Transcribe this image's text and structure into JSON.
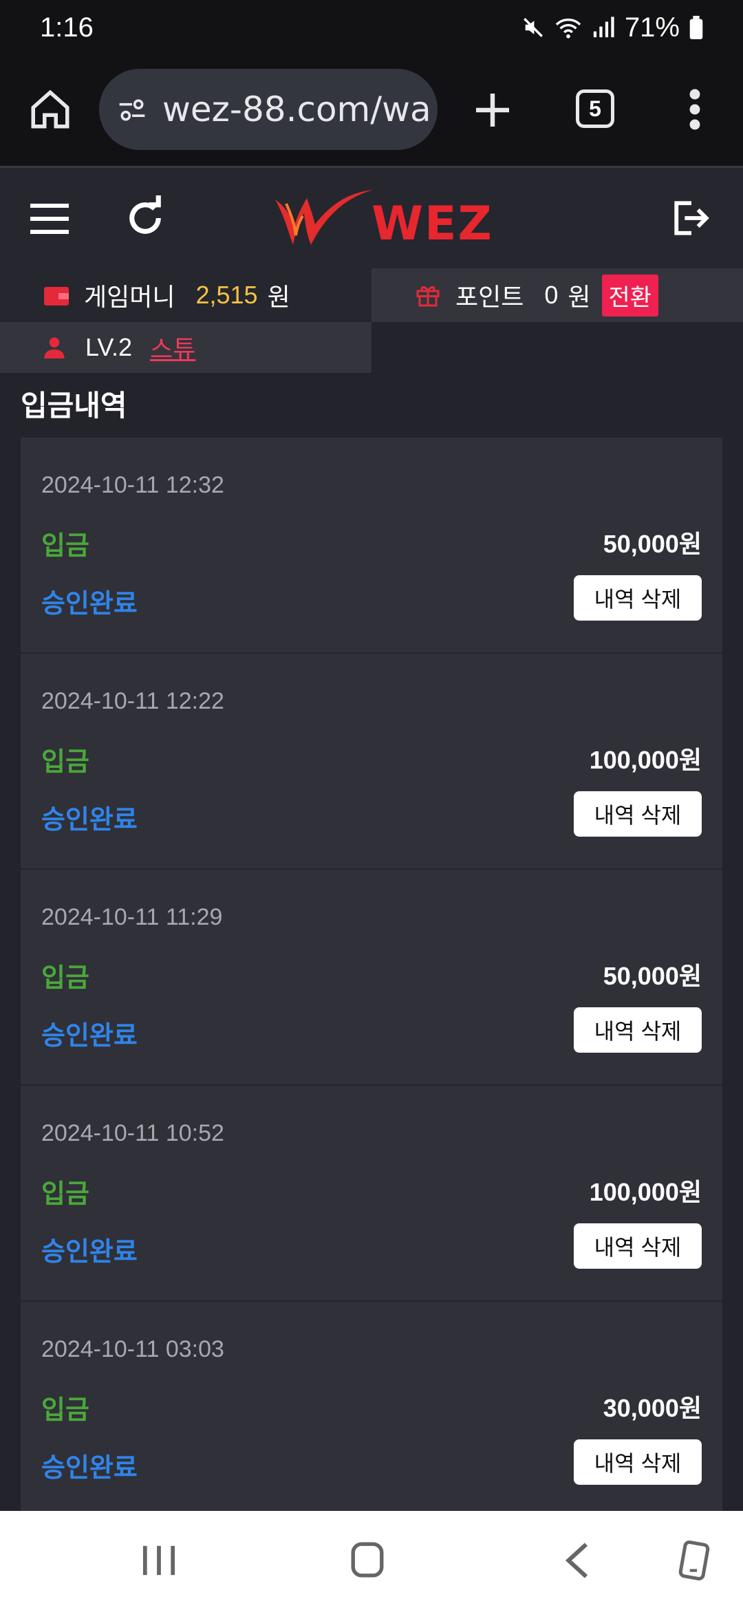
{
  "status_bar": {
    "time": "1:16",
    "battery": "71%"
  },
  "browser": {
    "url": "wez-88.com/wa",
    "tab_count": "5"
  },
  "header": {
    "logo_text": "WEZ"
  },
  "account": {
    "money_label": "게임머니",
    "money_value": "2,515",
    "money_unit": "원",
    "point_label": "포인트",
    "point_value": "0",
    "point_unit": "원",
    "convert_label": "전환",
    "level": "LV.2",
    "grade": "스튜"
  },
  "section_title": "입금내역",
  "deposits": [
    {
      "date": "2024-10-11 12:32",
      "type": "입금",
      "amount": "50,000원",
      "status": "승인완료",
      "delete_label": "내역 삭제"
    },
    {
      "date": "2024-10-11 12:22",
      "type": "입금",
      "amount": "100,000원",
      "status": "승인완료",
      "delete_label": "내역 삭제"
    },
    {
      "date": "2024-10-11 11:29",
      "type": "입금",
      "amount": "50,000원",
      "status": "승인완료",
      "delete_label": "내역 삭제"
    },
    {
      "date": "2024-10-11 10:52",
      "type": "입금",
      "amount": "100,000원",
      "status": "승인완료",
      "delete_label": "내역 삭제"
    },
    {
      "date": "2024-10-11 03:03",
      "type": "입금",
      "amount": "30,000원",
      "status": "승인완료",
      "delete_label": "내역 삭제"
    }
  ],
  "colors": {
    "accent": "#ee2150",
    "money": "#f5c243",
    "deposit_type": "#4aa83a",
    "status_approved": "#2f84ea"
  }
}
